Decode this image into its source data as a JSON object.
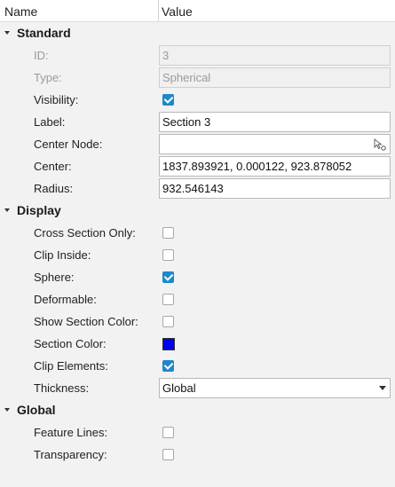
{
  "header": {
    "name_col": "Name",
    "value_col": "Value"
  },
  "standard": {
    "title": "Standard",
    "id_label": "ID:",
    "id_value": "3",
    "type_label": "Type:",
    "type_value": "Spherical",
    "visibility_label": "Visibility:",
    "visibility_checked": true,
    "label_label": "Label:",
    "label_value": "Section 3",
    "center_node_label": "Center Node:",
    "center_node_value": "",
    "center_label": "Center:",
    "center_value": "1837.893921, 0.000122, 923.878052",
    "radius_label": "Radius:",
    "radius_value": "932.546143"
  },
  "display": {
    "title": "Display",
    "cross_section_only_label": "Cross Section Only:",
    "cross_section_only_checked": false,
    "clip_inside_label": "Clip Inside:",
    "clip_inside_checked": false,
    "sphere_label": "Sphere:",
    "sphere_checked": true,
    "deformable_label": "Deformable:",
    "deformable_checked": false,
    "show_section_color_label": "Show Section Color:",
    "show_section_color_checked": false,
    "section_color_label": "Section Color:",
    "section_color": "#0000ee",
    "clip_elements_label": "Clip Elements:",
    "clip_elements_checked": true,
    "thickness_label": "Thickness:",
    "thickness_value": "Global"
  },
  "global": {
    "title": "Global",
    "feature_lines_label": "Feature Lines:",
    "feature_lines_checked": false,
    "transparency_label": "Transparency:",
    "transparency_checked": false
  },
  "colors": {
    "accent": "#1e88c9"
  }
}
